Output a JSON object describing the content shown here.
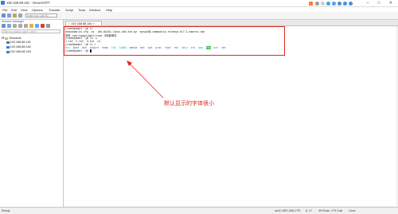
{
  "window": {
    "title": "192.168.88.161 - SecureCRT",
    "minimize": "–",
    "maximize": "□",
    "close": "✕"
  },
  "menu": [
    "File",
    "Edit",
    "View",
    "Options",
    "Transfer",
    "Script",
    "Tools",
    "Window",
    "Help"
  ],
  "toolbar": {
    "host_placeholder": "Enter host <Alt+R>"
  },
  "session_manager": {
    "title": "Session Manager",
    "filter_placeholder": "Filter by session name <Alt+I>",
    "root": "Sessions",
    "sessions": [
      "192.168.88.161",
      "192.168.88.162",
      "192.168.88.163"
    ]
  },
  "tab": {
    "check": "✓",
    "label": "192.168.88.161",
    "close": "×"
  },
  "terminal": {
    "lines": [
      "[root@node1 ~]# ll",
      "anaconda-ks.cfg  cs  jdk-8u241-linux-x64.tar.gz  mysql80-community-release-el7-1.noarch.rpm",
      "您有 /var/spool/mail/root 中有新邮件",
      "[root@node1 ~]# ls -c",
      "1.txt  2.txt  3.txt  cs",
      "[root@node1 ~]# cd /",
      "[root@node1 /]# ls",
      "[root@node1 ~]# ls",
      "[root@node1 ~]# "
    ],
    "ls_root": {
      "prompt": "[root@node1 ~]# ls /",
      "entries": [
        "bin",
        "boot",
        "dev",
        "export",
        "home",
        "lib",
        "lib64",
        "media",
        "mnt",
        "opt",
        "proc",
        "root",
        "run",
        "sbin",
        "srv",
        "sys",
        "tmp",
        "usr",
        "var"
      ],
      "blue": [
        "bin",
        "lib",
        "lib64",
        "sbin"
      ],
      "highlight": [
        "tmp"
      ]
    }
  },
  "annotation": {
    "text": "默认显示的字体很小",
    "color": "#d42a1f"
  },
  "status": {
    "left": "Ready",
    "ssh": "ssh2: AES-256-CTR",
    "pos": "8, 17",
    "size": "49 Rows, 179 Cols",
    "os": "Linux"
  }
}
